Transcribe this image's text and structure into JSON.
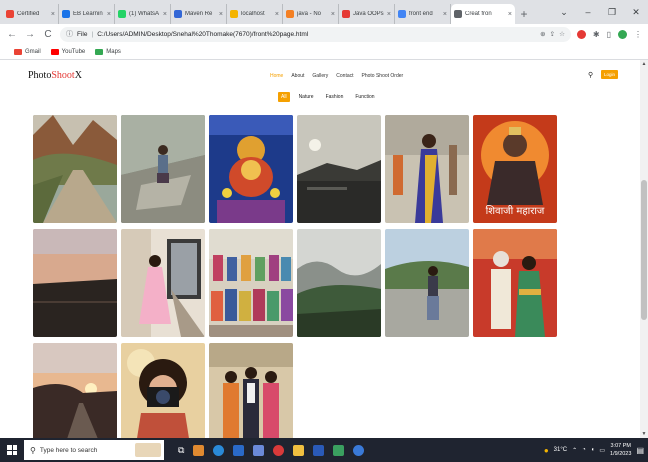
{
  "browser": {
    "tabs": [
      {
        "title": "Certified",
        "color": "#ea4335"
      },
      {
        "title": "EB Learnin",
        "color": "#1a73e8"
      },
      {
        "title": "(1) WhatsA",
        "color": "#25d366"
      },
      {
        "title": "Maven Re",
        "color": "#3367d6"
      },
      {
        "title": "localhost",
        "color": "#f4b400"
      },
      {
        "title": "java - No",
        "color": "#f48024"
      },
      {
        "title": "Java OOPs",
        "color": "#e53935"
      },
      {
        "title": "front end",
        "color": "#4285f4"
      },
      {
        "title": "Creat fron",
        "color": "#5f6368",
        "active": true
      }
    ],
    "tab_close": "×",
    "new_tab": "+",
    "window_controls": {
      "dropdown": "⌄",
      "minimize": "–",
      "maximize": "❐",
      "close": "✕"
    },
    "nav": {
      "back": "←",
      "forward": "→",
      "reload": "C"
    },
    "address": {
      "scheme": "File",
      "url": "C:/Users/ADMIN/Desktop/Snehal%20Thomake(7670)/front%20page.html"
    },
    "bookmarks": [
      {
        "label": "Gmail",
        "color": "#ea4335"
      },
      {
        "label": "YouTube",
        "color": "#ff0000"
      },
      {
        "label": "Maps",
        "color": "#34a853"
      }
    ]
  },
  "site": {
    "logo": {
      "part1": "Photo",
      "part2": "Shoot",
      "part3": "X"
    },
    "menu": [
      {
        "label": "Home",
        "active": true
      },
      {
        "label": "About"
      },
      {
        "label": "Gallery"
      },
      {
        "label": "Contact"
      },
      {
        "label": "Photo Shoot Order"
      }
    ],
    "login_label": "Login",
    "filters": [
      {
        "label": "All",
        "active": true
      },
      {
        "label": "Nature"
      },
      {
        "label": "Fashion"
      },
      {
        "label": "Function"
      }
    ],
    "photo_overlay_text": "शिवाजी महाराज"
  },
  "taskbar": {
    "search_placeholder": "Type here to search",
    "weather": "31°C",
    "time": "3:07 PM",
    "date": "1/9/2023"
  }
}
